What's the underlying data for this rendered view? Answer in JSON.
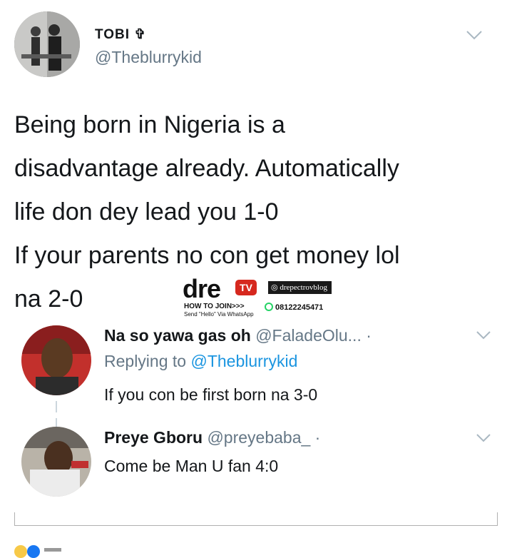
{
  "tweet": {
    "author_name": "TOBI ✞",
    "author_handle": "@Theblurrykid",
    "lines": [
      "Being born in Nigeria is a",
      "disadvantage already. Automatically",
      "life don dey lead you 1-0",
      "If your parents no con get money lol",
      "na 2-0"
    ]
  },
  "watermark": {
    "brand": "dre",
    "tv": "TV",
    "instagram": "drepectrovblog",
    "how_to_join": "HOW TO JOIN>>>",
    "send_hello": "Send \"Hello\" Via WhatsApp",
    "phone": "08122245471"
  },
  "replies": [
    {
      "name": "Na so yawa gas oh",
      "handle": "@FaladeOlu... ·",
      "replying_label": "Replying to",
      "replying_to": "@Theblurrykid",
      "text": "If you con be first born na 3-0"
    },
    {
      "name": "Preye Gboru",
      "handle": "@preyebaba_ ·",
      "text": "Come be Man U fan 4:0"
    }
  ],
  "colors": {
    "link": "#1b95e0",
    "muted": "#657786",
    "text": "#14171a"
  }
}
